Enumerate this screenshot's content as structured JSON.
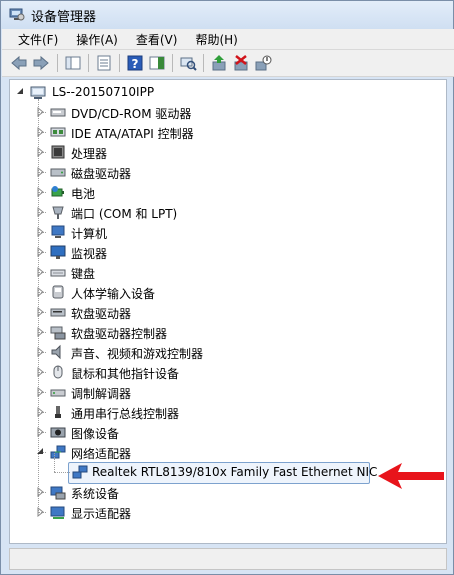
{
  "window": {
    "title": "设备管理器"
  },
  "menu": [
    "文件(F)",
    "操作(A)",
    "查看(V)",
    "帮助(H)"
  ],
  "toolbar": [
    {
      "icon": "back-arrow-icon"
    },
    {
      "icon": "forward-arrow-icon"
    },
    {
      "icon": "console-tree-icon"
    },
    {
      "icon": "properties-icon"
    },
    {
      "icon": "help-icon"
    },
    {
      "icon": "action-pane-icon"
    },
    {
      "icon": "scan-hardware-icon"
    },
    {
      "icon": "update-driver-icon"
    },
    {
      "icon": "uninstall-icon"
    },
    {
      "icon": "disable-device-icon"
    }
  ],
  "tree": {
    "root": "LS--20150710IPP",
    "items": [
      {
        "label": "DVD/CD-ROM 驱动器",
        "icon": "dvd-drive-icon"
      },
      {
        "label": "IDE ATA/ATAPI 控制器",
        "icon": "ide-controller-icon"
      },
      {
        "label": "处理器",
        "icon": "processor-icon"
      },
      {
        "label": "磁盘驱动器",
        "icon": "disk-drive-icon"
      },
      {
        "label": "电池",
        "icon": "battery-icon"
      },
      {
        "label": "端口 (COM 和 LPT)",
        "icon": "port-icon"
      },
      {
        "label": "计算机",
        "icon": "computer-icon"
      },
      {
        "label": "监视器",
        "icon": "monitor-icon"
      },
      {
        "label": "键盘",
        "icon": "keyboard-icon"
      },
      {
        "label": "人体学输入设备",
        "icon": "hid-icon"
      },
      {
        "label": "软盘驱动器",
        "icon": "floppy-drive-icon"
      },
      {
        "label": "软盘驱动器控制器",
        "icon": "floppy-controller-icon"
      },
      {
        "label": "声音、视频和游戏控制器",
        "icon": "speaker-icon"
      },
      {
        "label": "鼠标和其他指针设备",
        "icon": "mouse-icon"
      },
      {
        "label": "调制解调器",
        "icon": "modem-icon"
      },
      {
        "label": "通用串行总线控制器",
        "icon": "usb-icon"
      },
      {
        "label": "图像设备",
        "icon": "camera-icon"
      },
      {
        "label": "网络适配器",
        "icon": "network-adapter-icon",
        "expanded": true,
        "children": [
          {
            "label": "Realtek RTL8139/810x Family Fast Ethernet NIC",
            "icon": "network-card-icon",
            "selected": true
          }
        ]
      },
      {
        "label": "系统设备",
        "icon": "system-device-icon"
      },
      {
        "label": "显示适配器",
        "icon": "display-adapter-icon"
      }
    ]
  },
  "colors": {
    "annotation_arrow": "#e8141b",
    "selection_border": "#7da2ce"
  }
}
